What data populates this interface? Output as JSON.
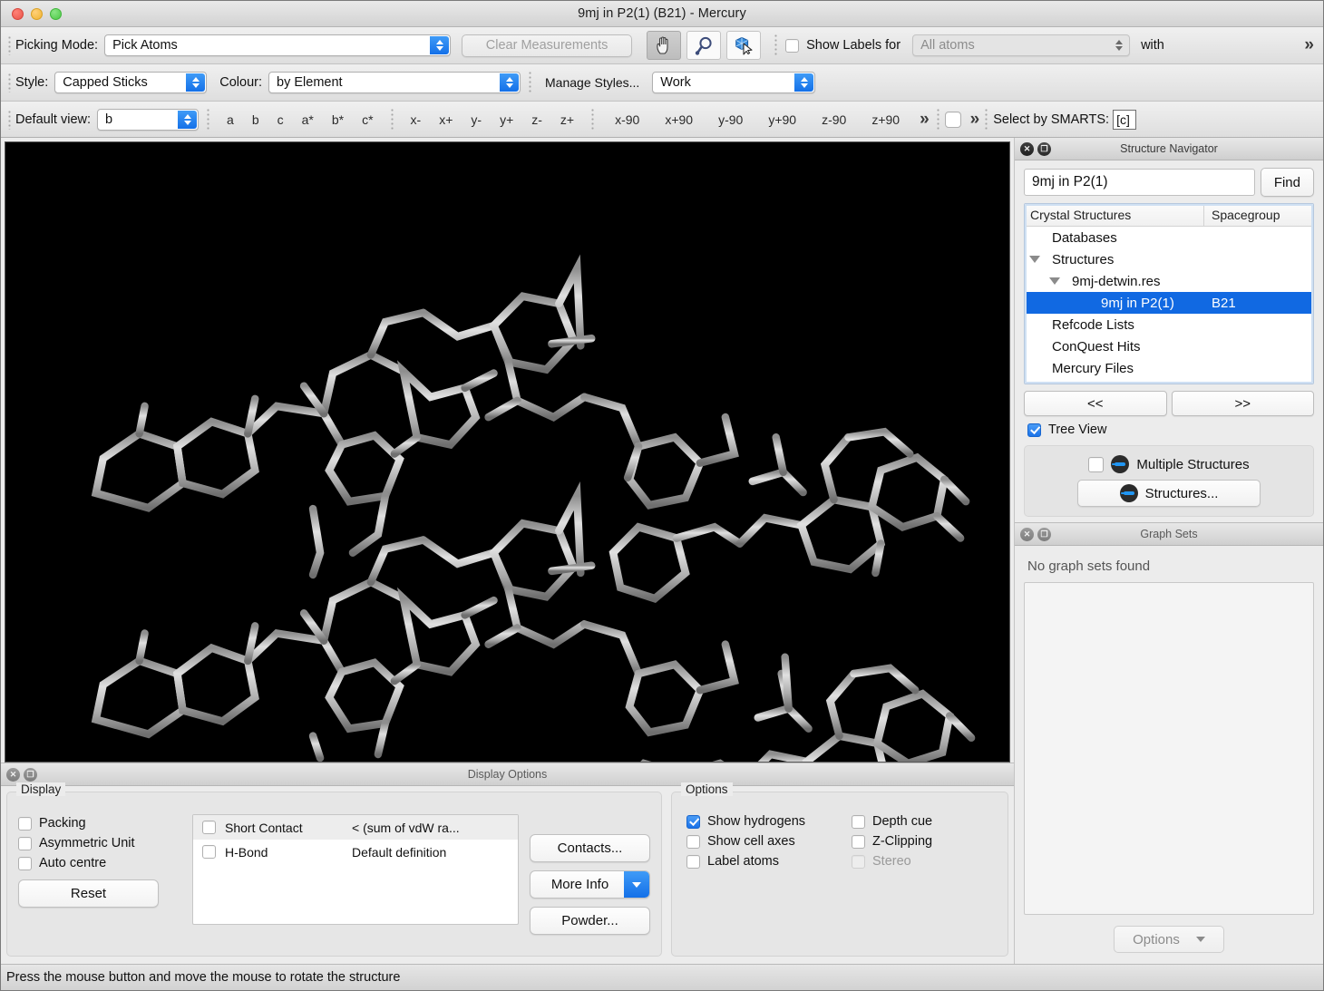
{
  "window": {
    "title": "9mj in P2(1) (B21) - Mercury",
    "traffic_lights": [
      "close-button",
      "minimize-button",
      "zoom-button"
    ]
  },
  "toolbar1": {
    "picking_mode_label": "Picking Mode:",
    "picking_mode_value": "Pick Atoms",
    "clear_measurements": "Clear Measurements",
    "icons": [
      "hand-icon",
      "magnifier-icon",
      "pick-molecule-icon"
    ],
    "show_labels_label": "Show Labels for",
    "show_labels_checked": false,
    "all_atoms_value": "All atoms",
    "with_label": "with",
    "overflow": "»"
  },
  "toolbar2": {
    "style_label": "Style:",
    "style_value": "Capped Sticks",
    "colour_label": "Colour:",
    "colour_value": "by Element",
    "manage_styles": "Manage Styles...",
    "work_value": "Work"
  },
  "toolbar3": {
    "default_view_label": "Default view:",
    "default_view_value": "b",
    "axis_buttons": [
      "a",
      "b",
      "c",
      "a*",
      "b*",
      "c*"
    ],
    "dir_buttons": [
      "x-",
      "x+",
      "y-",
      "y+",
      "z-",
      "z+"
    ],
    "rot_buttons": [
      "x-90",
      "x+90",
      "y-90",
      "y+90",
      "z-90",
      "z+90"
    ],
    "overflow1": "»",
    "overflow2": "»",
    "smarts_label": "Select by SMARTS:",
    "smarts_value": "[c]"
  },
  "viewport": {
    "background": "#000000",
    "molecule_color": "#b9b9b9",
    "style": "capped-sticks"
  },
  "structure_navigator": {
    "panel_title": "Structure Navigator",
    "search_value": "9mj in P2(1)",
    "find_label": "Find",
    "columns": [
      "Crystal Structures",
      "Spacegroup"
    ],
    "rows": [
      {
        "label": "Databases",
        "spacegroup": "",
        "indent": 1,
        "twisty": false,
        "selected": false
      },
      {
        "label": "Structures",
        "spacegroup": "",
        "indent": 1,
        "twisty": true,
        "selected": false
      },
      {
        "label": "9mj-detwin.res",
        "spacegroup": "",
        "indent": 2,
        "twisty": true,
        "selected": false
      },
      {
        "label": "9mj in P2(1)",
        "spacegroup": "B21",
        "indent": 3,
        "twisty": false,
        "selected": true
      },
      {
        "label": "Refcode Lists",
        "spacegroup": "",
        "indent": 1,
        "twisty": false,
        "selected": false
      },
      {
        "label": "ConQuest Hits",
        "spacegroup": "",
        "indent": 1,
        "twisty": false,
        "selected": false
      },
      {
        "label": "Mercury Files",
        "spacegroup": "",
        "indent": 1,
        "twisty": false,
        "selected": false
      }
    ],
    "prev_label": "<<",
    "next_label": ">>",
    "tree_view_label": "Tree View",
    "tree_view_checked": true,
    "multiple_structures_label": "Multiple Structures",
    "multiple_structures_checked": false,
    "structures_button": "Structures...",
    "selection_color": "#1169e2"
  },
  "graph_sets": {
    "panel_title": "Graph Sets",
    "empty_message": "No graph sets found",
    "options_label": "Options"
  },
  "display_options": {
    "panel_title": "Display Options",
    "display_group": "Display",
    "checkboxes": [
      {
        "label": "Packing",
        "checked": false
      },
      {
        "label": "Asymmetric Unit",
        "checked": false
      },
      {
        "label": "Auto centre",
        "checked": false
      }
    ],
    "reset_label": "Reset",
    "contacts_table": [
      {
        "name": "Short Contact",
        "definition": "< (sum of vdW ra...",
        "checked": false
      },
      {
        "name": "H-Bond",
        "definition": "Default definition",
        "checked": false
      }
    ],
    "buttons": [
      {
        "label": "Contacts...",
        "has_dropdown": false
      },
      {
        "label": "More Info",
        "has_dropdown": true
      },
      {
        "label": "Powder...",
        "has_dropdown": false
      }
    ],
    "options_group": "Options",
    "options_left": [
      {
        "label": "Show hydrogens",
        "checked": true,
        "disabled": false
      },
      {
        "label": "Show cell axes",
        "checked": false,
        "disabled": false
      },
      {
        "label": "Label atoms",
        "checked": false,
        "disabled": false
      }
    ],
    "options_right": [
      {
        "label": "Depth cue",
        "checked": false,
        "disabled": false
      },
      {
        "label": "Z-Clipping",
        "checked": false,
        "disabled": false
      },
      {
        "label": "Stereo",
        "checked": false,
        "disabled": true
      }
    ]
  },
  "statusbar": {
    "message": "Press the mouse button and move the mouse to rotate the structure"
  }
}
